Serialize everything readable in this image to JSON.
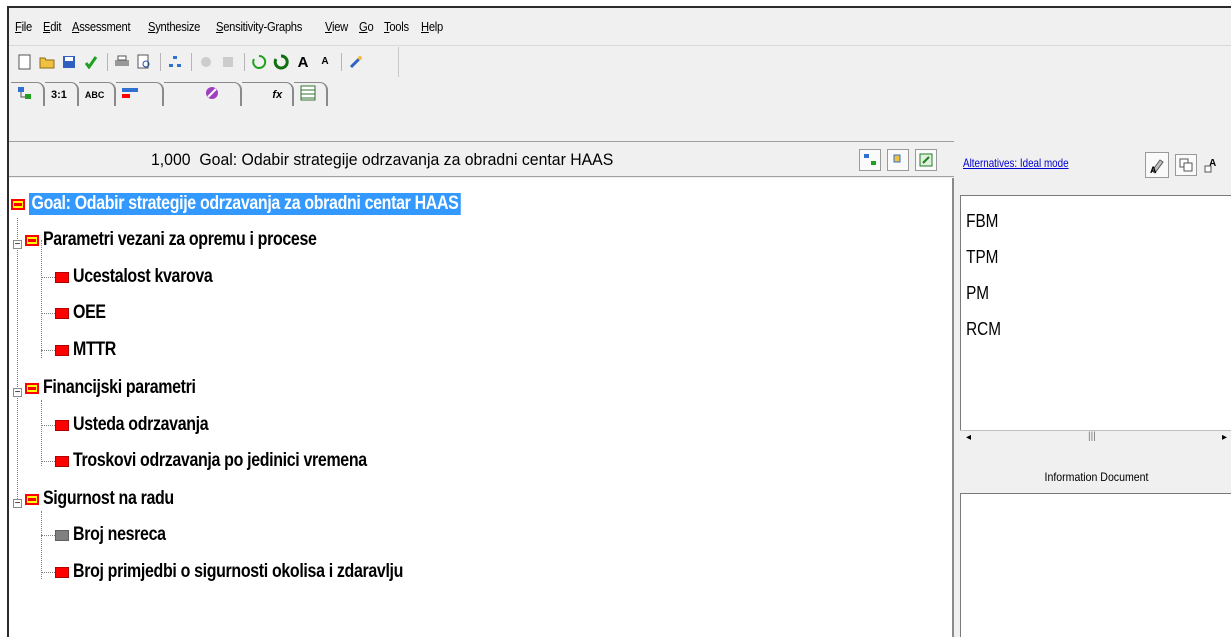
{
  "menu": [
    {
      "label": "File"
    },
    {
      "label": "Edit"
    },
    {
      "label": "Assessment"
    },
    {
      "label": "Synthesize"
    },
    {
      "label": "Sensitivity-Graphs"
    },
    {
      "label": "View"
    },
    {
      "label": "Go"
    },
    {
      "label": "Tools"
    },
    {
      "label": "Help"
    }
  ],
  "tabs": [
    {
      "label": "",
      "icon": "tree-view-icon"
    },
    {
      "label": "3:1",
      "icon": "pairwise-numerical-icon"
    },
    {
      "label": "ABC",
      "icon": "pairwise-verbal-icon"
    },
    {
      "label": "",
      "icon": "pairwise-graphical-icon"
    },
    {
      "label": "",
      "icon": "questionnaire-icon"
    },
    {
      "label": "fx",
      "icon": "formula-icon"
    },
    {
      "label": "",
      "icon": "data-grid-icon"
    }
  ],
  "header": {
    "priority": "1,000",
    "goal_text": "Goal: Odabir strategije odrzavanja za obradni centar HAAS"
  },
  "tree": {
    "goal": "Goal: Odabir strategije odrzavanja za obradni centar HAAS",
    "groups": [
      {
        "label": "Parametri vezani za opremu i procese",
        "children": [
          "Ucestalost kvarova",
          "OEE",
          "MTTR"
        ]
      },
      {
        "label": "Financijski parametri",
        "children": [
          "Usteda odrzavanja",
          "Troskovi odrzavanja po jedinici vremena"
        ]
      },
      {
        "label": "Sigurnost na radu",
        "children": [
          "Broj nesreca",
          "Broj primjedbi o sigurnosti okolisa i zdaravlju"
        ]
      }
    ]
  },
  "right_panel": {
    "alternatives_link": "Alternatives: Ideal mode",
    "alternatives": [
      "FBM",
      "TPM",
      "PM",
      "RCM"
    ],
    "info_label": "Information Document"
  },
  "colors": {
    "selection": "#3399ff",
    "node_red": "#ff0000",
    "node_yellow": "#ffff00",
    "node_gray": "#808080",
    "link": "#0000cc"
  }
}
